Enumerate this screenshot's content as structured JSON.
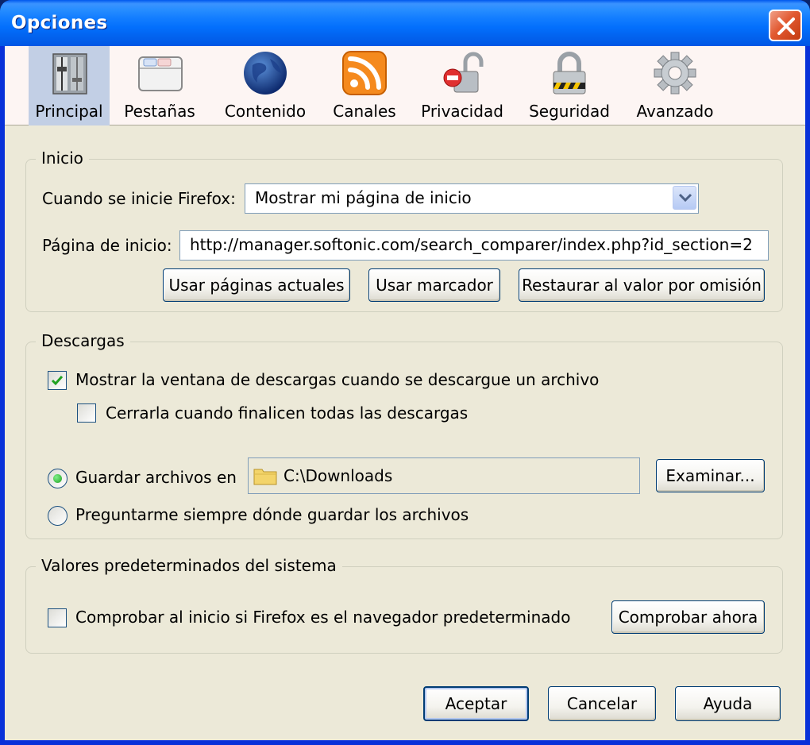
{
  "window": {
    "title": "Opciones"
  },
  "tabs": [
    {
      "label": "Principal",
      "icon": "sliders-icon"
    },
    {
      "label": "Pestañas",
      "icon": "tabs-window-icon"
    },
    {
      "label": "Contenido",
      "icon": "globe-icon"
    },
    {
      "label": "Canales",
      "icon": "rss-feed-icon"
    },
    {
      "label": "Privacidad",
      "icon": "open-lock-icon"
    },
    {
      "label": "Seguridad",
      "icon": "padlock-icon"
    },
    {
      "label": "Avanzado",
      "icon": "gear-icon"
    }
  ],
  "inicio": {
    "legend": "Inicio",
    "startup_label": "Cuando se inicie Firefox:",
    "startup_value": "Mostrar mi página de inicio",
    "homepage_label": "Página de inicio:",
    "homepage_value": "http://manager.softonic.com/search_comparer/index.php?id_section=2",
    "btn_current": "Usar páginas actuales",
    "btn_bookmark": "Usar marcador",
    "btn_restore": "Restaurar al valor por omisión"
  },
  "descargas": {
    "legend": "Descargas",
    "show_window_label": "Mostrar la ventana de descargas cuando se descargue un archivo",
    "show_window_checked": true,
    "close_when_done_label": "Cerrarla cuando finalicen todas las descargas",
    "close_when_done_checked": false,
    "save_to_label": "Guardar archivos en",
    "save_to_path": "C:\\Downloads",
    "browse_button": "Examinar...",
    "ask_label": "Preguntarme siempre dónde guardar los archivos",
    "selected_option": "save_to"
  },
  "sistema": {
    "legend": "Valores predeterminados del sistema",
    "check_default_label": "Comprobar al inicio si Firefox es el navegador predeterminado",
    "check_default_checked": false,
    "check_now_button": "Comprobar ahora"
  },
  "footer": {
    "accept": "Aceptar",
    "cancel": "Cancelar",
    "help": "Ayuda"
  },
  "colors": {
    "titlebar": "#0058ee",
    "dialog_bg": "#ece9d8",
    "toolbar_bg": "#fdf5f3",
    "selected_tab": "#c2cfe5",
    "close_button": "#e25a32"
  }
}
